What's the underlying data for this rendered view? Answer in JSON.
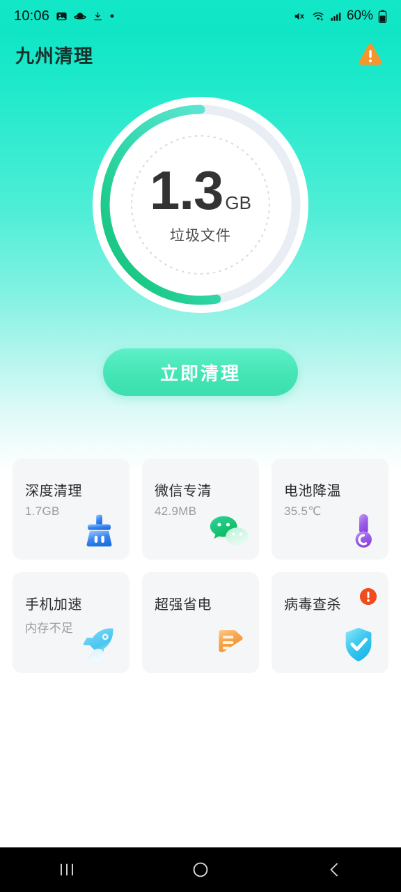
{
  "statusbar": {
    "time": "10:06",
    "battery_percent": "60%",
    "left_icons": [
      "image-icon",
      "saturn-icon",
      "download-icon",
      "dot-icon"
    ],
    "right_icons": [
      "mute-icon",
      "wifi-icon",
      "signal-icon",
      "battery-icon"
    ]
  },
  "header": {
    "app_title": "九州清理",
    "warning_icon": "warning-triangle-icon"
  },
  "gauge": {
    "value": "1.3",
    "unit": "GB",
    "label": "垃圾文件",
    "progress_percent": 55,
    "arc_color_start": "#5ae3d0",
    "arc_color_end": "#18c47d",
    "track_color": "#e9edf3"
  },
  "clean_button": {
    "label": "立即清理",
    "color": "#45e5b6"
  },
  "features": [
    {
      "title": "深度清理",
      "subtitle": "1.7GB",
      "icon": "broom-icon",
      "icon_color": "#2f80ed",
      "badge": null
    },
    {
      "title": "微信专清",
      "subtitle": "42.9MB",
      "icon": "wechat-icon",
      "icon_color": "#09bb61",
      "badge": null
    },
    {
      "title": "电池降温",
      "subtitle": "35.5℃",
      "icon": "thermometer-icon",
      "icon_color": "#9b5de5",
      "badge": null
    },
    {
      "title": "手机加速",
      "subtitle": "内存不足",
      "icon": "rocket-icon",
      "icon_color": "#4cc9f0",
      "badge": null
    },
    {
      "title": "超强省电",
      "subtitle": "",
      "icon": "battery-save-icon",
      "icon_color": "#f2994a",
      "badge": null
    },
    {
      "title": "病毒查杀",
      "subtitle": "",
      "icon": "shield-check-icon",
      "icon_color": "#29c4f0",
      "badge": "alert-badge-icon"
    }
  ],
  "navbar": {
    "recents_label": "recents-icon",
    "home_label": "home-icon",
    "back_label": "back-icon"
  }
}
